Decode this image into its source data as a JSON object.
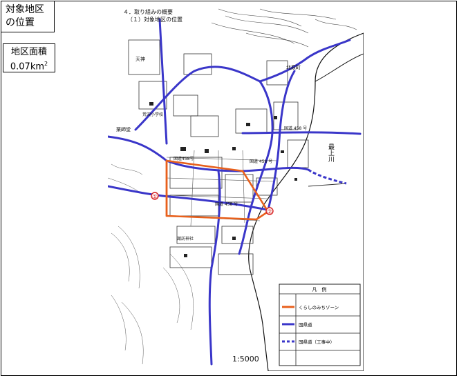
{
  "location_label": {
    "line1": "対象地区",
    "line2": "の位置"
  },
  "area": {
    "label": "地区面積",
    "value": "0.07km",
    "sup": "2"
  },
  "map": {
    "heading1": "４．取り組みの概要",
    "heading2": "（１）対象地区の位置",
    "scale": "1:5000",
    "roads": {
      "route458_a": "国道458号",
      "route458_b": "国道 458 号",
      "route458_c": "国道 458 号",
      "route458_d": "国道 458 号"
    },
    "river": "最上川",
    "places": {
      "school": "荒沢小学校",
      "shrine": "諏訪神社",
      "kitaharaka": "北原町",
      "yakushido": "薬師堂",
      "tenjin": "天神",
      "marker1": "①",
      "marker2": "②"
    },
    "legend": {
      "title": "凡　例",
      "items": [
        {
          "label": "くらしのみちゾーン",
          "color": "#e8601c",
          "style": "solid"
        },
        {
          "label": "国県道",
          "color": "#3a36c9",
          "style": "solid"
        },
        {
          "label": "国県道（工事中）",
          "color": "#3a36c9",
          "style": "dashed"
        }
      ]
    },
    "colors": {
      "zone": "#e8601c",
      "road": "#3a36c9",
      "ink": "#222222"
    }
  }
}
